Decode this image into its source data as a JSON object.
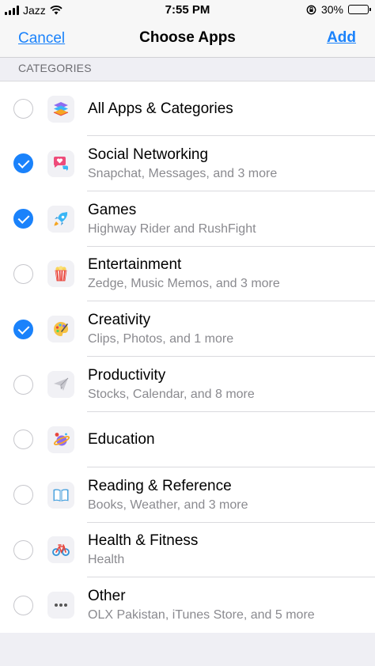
{
  "status_bar": {
    "carrier": "Jazz",
    "time": "7:55 PM",
    "battery": "30%",
    "battery_level": 0.3
  },
  "nav": {
    "cancel_label": "Cancel",
    "title": "Choose Apps",
    "add_label": "Add"
  },
  "section": {
    "header": "CATEGORIES"
  },
  "categories": [
    {
      "label": "All Apps & Categories",
      "subtitle": "",
      "selected": false,
      "icon": "stack-icon"
    },
    {
      "label": "Social Networking",
      "subtitle": "Snapchat, Messages, and 3 more",
      "selected": true,
      "icon": "chat-heart-icon"
    },
    {
      "label": "Games",
      "subtitle": "Highway Rider and RushFight",
      "selected": true,
      "icon": "rocket-icon"
    },
    {
      "label": "Entertainment",
      "subtitle": "Zedge, Music Memos, and 3 more",
      "selected": false,
      "icon": "popcorn-icon"
    },
    {
      "label": "Creativity",
      "subtitle": "Clips, Photos, and 1 more",
      "selected": true,
      "icon": "palette-icon"
    },
    {
      "label": "Productivity",
      "subtitle": "Stocks, Calendar, and 8 more",
      "selected": false,
      "icon": "paper-plane-icon"
    },
    {
      "label": "Education",
      "subtitle": "",
      "selected": false,
      "icon": "planet-icon"
    },
    {
      "label": "Reading & Reference",
      "subtitle": "Books, Weather, and 3 more",
      "selected": false,
      "icon": "book-icon"
    },
    {
      "label": "Health & Fitness",
      "subtitle": "Health",
      "selected": false,
      "icon": "bicycle-icon"
    },
    {
      "label": "Other",
      "subtitle": "OLX Pakistan, iTunes Store, and 5 more",
      "selected": false,
      "icon": "more-dots-icon"
    }
  ],
  "colors": {
    "accent": "#1a82fb",
    "separator": "#dadade",
    "subtitle": "#8a8a8f"
  }
}
